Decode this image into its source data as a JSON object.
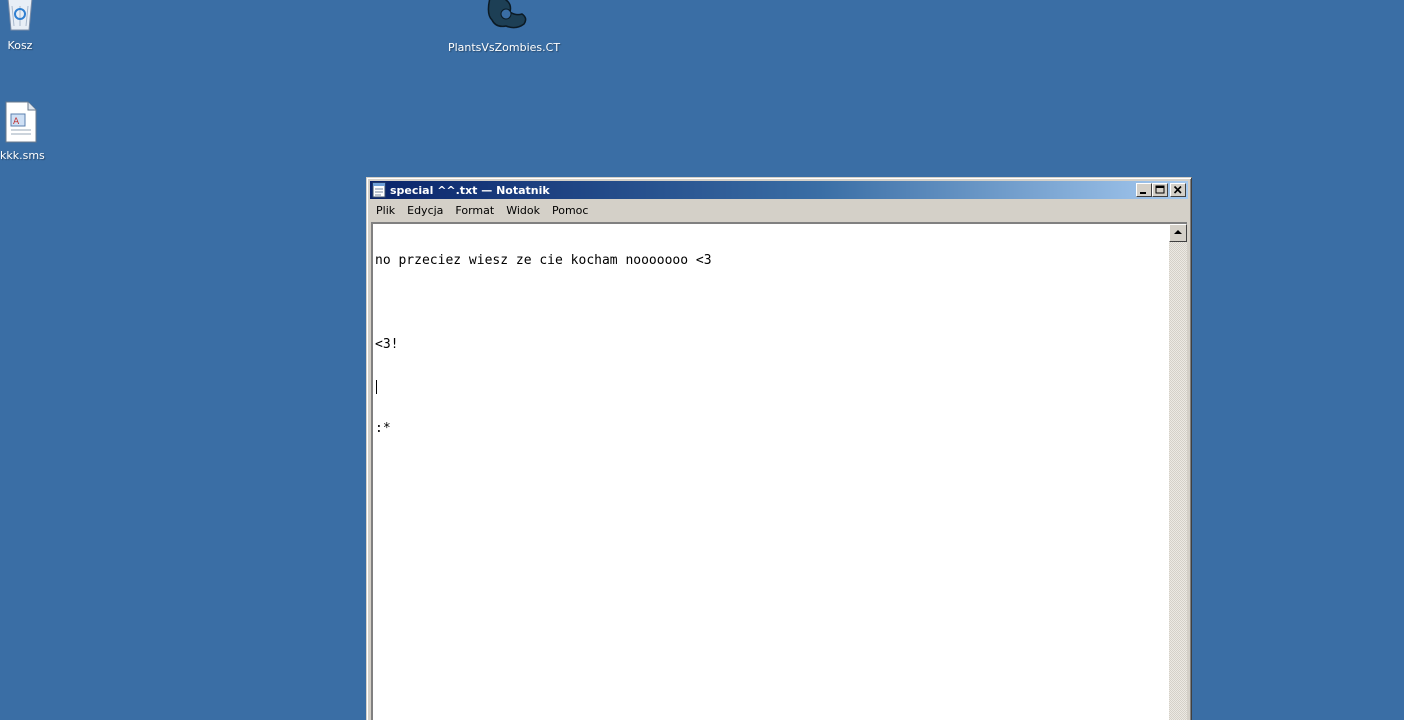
{
  "desktop": {
    "icons": [
      {
        "label": "Kosz",
        "icon": "recycle-bin-icon"
      },
      {
        "label": "PlantsVsZombies.CT",
        "icon": "cheat-engine-gear-icon"
      },
      {
        "label": "kkk.sms",
        "icon": "document-icon"
      }
    ],
    "background_color": "#3a6ea5"
  },
  "window": {
    "title": "special ^^.txt — Notatnik",
    "title_icon": "notepad-icon",
    "controls": {
      "minimize": "minimize-icon",
      "maximize": "maximize-icon",
      "close": "close-icon"
    },
    "menu": [
      "Plik",
      "Edycja",
      "Format",
      "Widok",
      "Pomoc"
    ],
    "content": {
      "lines": [
        "no przeciez wiesz ze cie kocham nooooooo <3",
        "",
        "<3!",
        "",
        ":*"
      ]
    }
  }
}
